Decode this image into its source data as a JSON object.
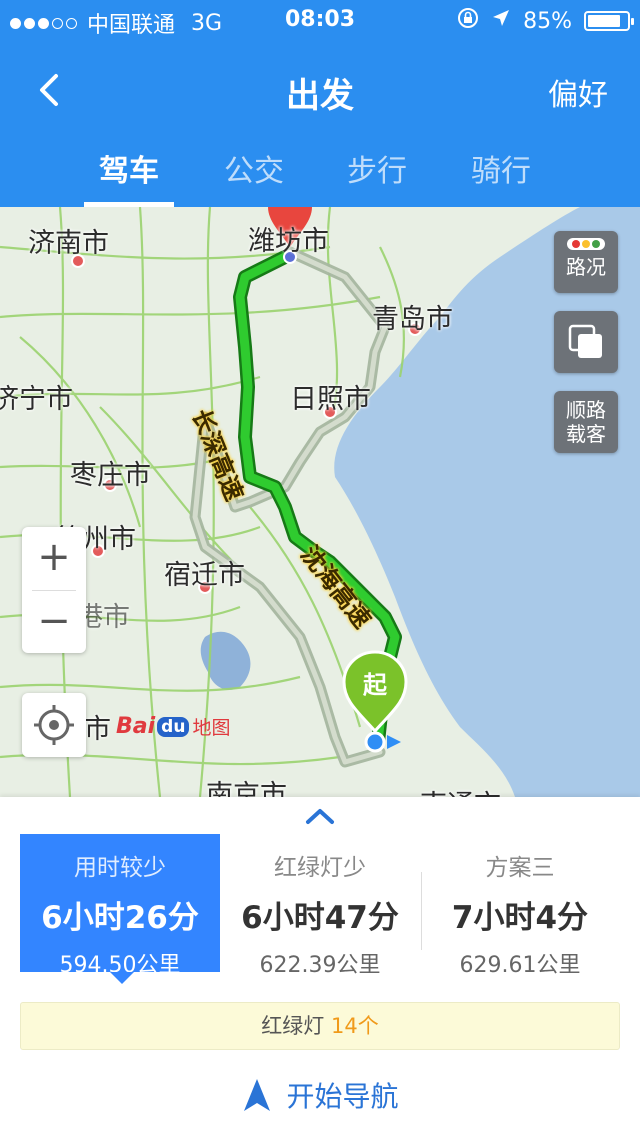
{
  "status_bar": {
    "carrier": "中国联通",
    "network": "3G",
    "time": "08:03",
    "battery": "85%",
    "battery_level": 0.85
  },
  "nav": {
    "title": "出发",
    "preferences_label": "偏好"
  },
  "tabs": [
    {
      "label": "驾车",
      "active": true
    },
    {
      "label": "公交",
      "active": false
    },
    {
      "label": "步行",
      "active": false
    },
    {
      "label": "骑行",
      "active": false
    }
  ],
  "map": {
    "cities": [
      "济南市",
      "潍坊市",
      "青岛市",
      "济宁市",
      "日照市",
      "枣庄市",
      "徐州市",
      "宿迁市",
      "淮安市",
      "南京市",
      "南通市",
      "连云港市"
    ],
    "highways": [
      "长深高速",
      "沈海高速"
    ],
    "start_marker": "起",
    "buttons": {
      "traffic": "路况",
      "ride_share": "顺路载客"
    },
    "zoom_in": "+",
    "zoom_out": "−",
    "logo": {
      "bai": "Bai",
      "du": "du",
      "ditu": "地图"
    },
    "colors": {
      "route": "#23b523",
      "alt_route": "#a6b6a0",
      "sea": "#a9c9e8",
      "land": "#e8efe4"
    }
  },
  "routes": [
    {
      "title": "用时较少",
      "time": "6小时26分",
      "distance": "594.50公里",
      "selected": true
    },
    {
      "title": "红绿灯少",
      "time": "6小时47分",
      "distance": "622.39公里",
      "selected": false
    },
    {
      "title": "方案三",
      "time": "7小时4分",
      "distance": "629.61公里",
      "selected": false
    }
  ],
  "traffic_lights": {
    "label": "红绿灯",
    "count": "14个"
  },
  "start_navigation_label": "开始导航",
  "colors": {
    "header": "#2b8ef0",
    "selected_route": "#3385ff",
    "lights_count": "#f09a1a",
    "start_nav": "#2a74d6"
  }
}
